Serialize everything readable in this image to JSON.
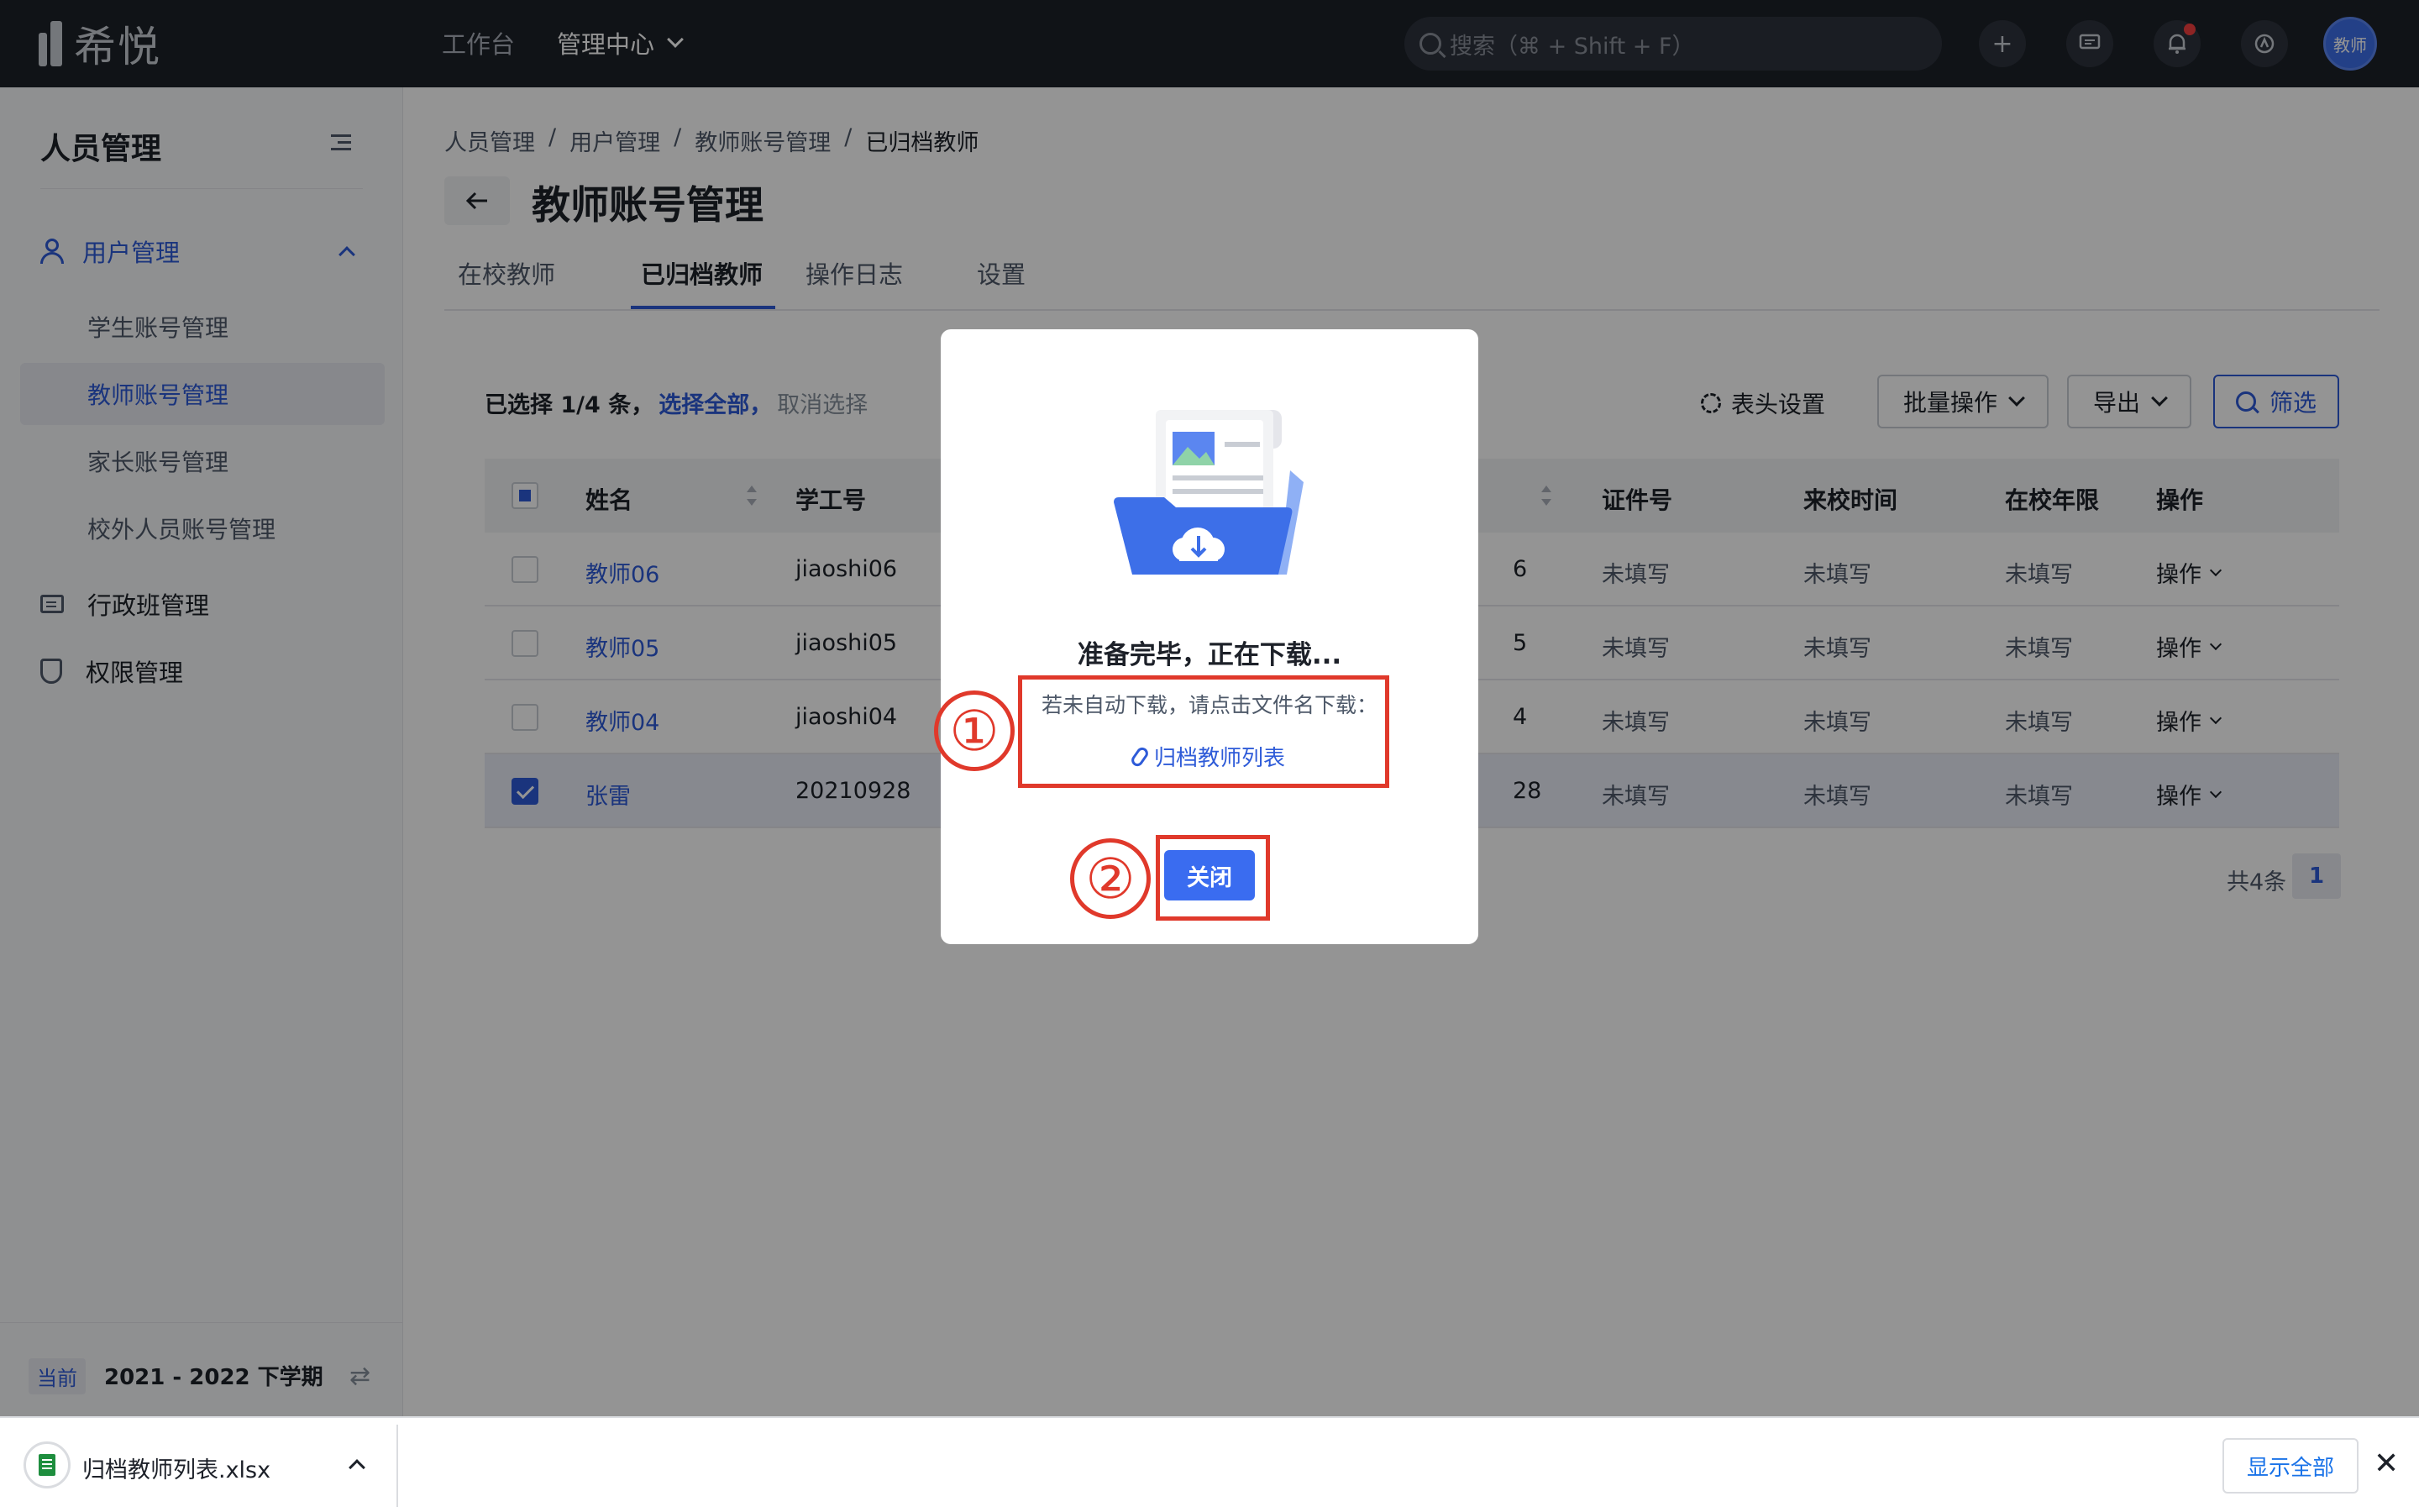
{
  "topbar": {
    "logo_text": "希悦",
    "nav": [
      "工作台",
      "管理中心"
    ],
    "search_placeholder": "搜索（⌘ + Shift + F）",
    "avatar_text": "教师"
  },
  "sidebar": {
    "title": "人员管理",
    "group": "用户管理",
    "sub_items": [
      "学生账号管理",
      "教师账号管理",
      "家长账号管理",
      "校外人员账号管理"
    ],
    "items": [
      "行政班管理",
      "权限管理"
    ],
    "term_badge": "当前",
    "term": "2021 - 2022 下学期"
  },
  "main": {
    "breadcrumb": [
      "人员管理",
      "/",
      "用户管理",
      "/",
      "教师账号管理",
      "/",
      "已归档教师"
    ],
    "title": "教师账号管理",
    "tabs": [
      "在校教师",
      "已归档教师",
      "操作日志",
      "设置"
    ],
    "selection": {
      "prefix": "已选择 1/4 条，",
      "select_all": "选择全部，",
      "cancel": "取消选择"
    },
    "toolbar": {
      "header_settings": "表头设置",
      "batch": "批量操作",
      "export": "导出",
      "filter": "筛选"
    },
    "table": {
      "headers": [
        "姓名",
        "学工号",
        "证件号",
        "来校时间",
        "在校年限",
        "操作"
      ],
      "rows": [
        {
          "name": "教师06",
          "id": "jiaoshi06",
          "partial": "6",
          "cert": "未填写",
          "join": "未填写",
          "years": "未填写",
          "op": "操作"
        },
        {
          "name": "教师05",
          "id": "jiaoshi05",
          "partial": "5",
          "cert": "未填写",
          "join": "未填写",
          "years": "未填写",
          "op": "操作"
        },
        {
          "name": "教师04",
          "id": "jiaoshi04",
          "partial": "4",
          "cert": "未填写",
          "join": "未填写",
          "years": "未填写",
          "op": "操作"
        },
        {
          "name": "张雷",
          "id": "20210928",
          "partial": "28",
          "cert": "未填写",
          "join": "未填写",
          "years": "未填写",
          "op": "操作"
        }
      ]
    },
    "pagination": {
      "total": "共4条",
      "page": "1"
    }
  },
  "modal": {
    "title": "准备完毕，正在下载...",
    "hint": "若未自动下载，请点击文件名下载：",
    "file_link": "归档教师列表",
    "close": "关闭"
  },
  "annotations": [
    "①",
    "②"
  ],
  "download_bar": {
    "file_name": "归档教师列表.xlsx",
    "show_all": "显示全部",
    "close": "✕"
  },
  "colors": {
    "accent": "#2e5bd8",
    "topbar": "#1d2129",
    "annotation": "#e0392b"
  }
}
